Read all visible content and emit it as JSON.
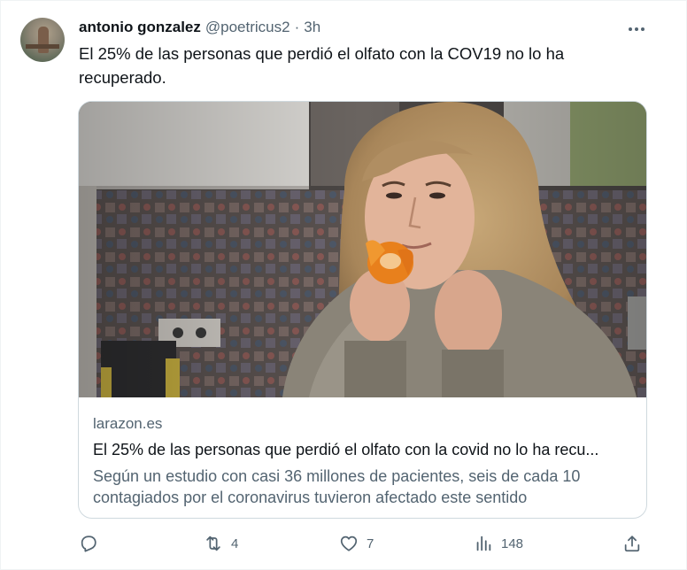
{
  "tweet": {
    "author_name": "antonio gonzalez",
    "handle": "@poetricus2",
    "separator": "·",
    "time": "3h",
    "text": "El 25% de las personas que perdió el olfato con la COV19 no lo ha recuperado."
  },
  "card": {
    "domain": "larazon.es",
    "title": "El 25% de las personas que perdió el olfato con la covid no lo ha recu...",
    "description": "Según un estudio con casi 36 millones de pacientes, seis de cada 10 contagiados por el coronavirus tuvieron afectado este sentido"
  },
  "actions": {
    "reply_icon": "reply-icon",
    "reply_count": "",
    "retweet_icon": "retweet-icon",
    "retweet_count": "4",
    "like_icon": "heart-icon",
    "like_count": "7",
    "views_icon": "analytics-icon",
    "views_count": "148",
    "share_icon": "share-icon"
  },
  "colors": {
    "primary_text": "#0f1419",
    "secondary_text": "#536471",
    "border": "#cfd9de"
  }
}
